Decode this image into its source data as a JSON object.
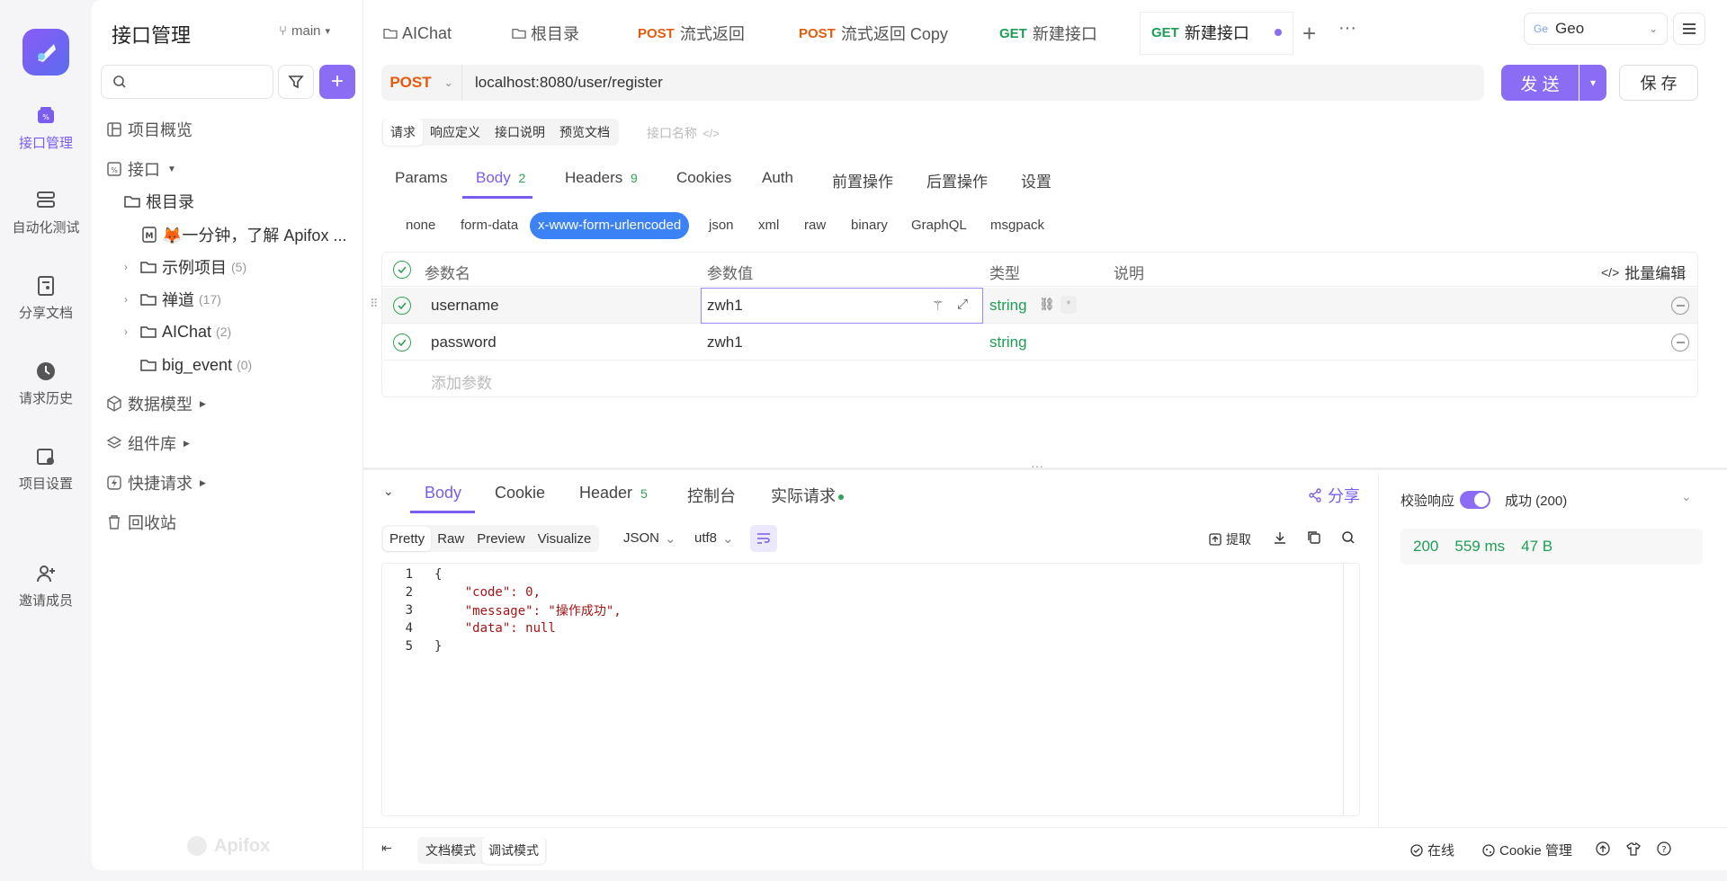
{
  "rail": {
    "items": [
      {
        "label": "接口管理",
        "icon": "api-management-icon"
      },
      {
        "label": "自动化测试",
        "icon": "automation-icon"
      },
      {
        "label": "分享文档",
        "icon": "share-doc-icon"
      },
      {
        "label": "请求历史",
        "icon": "history-icon"
      },
      {
        "label": "项目设置",
        "icon": "project-settings-icon"
      },
      {
        "label": "邀请成员",
        "icon": "invite-user-icon"
      }
    ]
  },
  "panel": {
    "title": "接口管理",
    "branch": "main",
    "search": {
      "value": "",
      "placeholder": ""
    },
    "nav": {
      "overview": "项目概览",
      "apis": "接口",
      "data_model": "数据模型",
      "components": "组件库",
      "quick_request": "快捷请求",
      "trash": "回收站"
    },
    "tree": {
      "root": "根目录",
      "intro": "🦊一分钟，了解 Apifox ...",
      "folders": [
        {
          "name": "示例项目",
          "count": "(5)"
        },
        {
          "name": "禅道",
          "count": "(17)"
        },
        {
          "name": "AIChat",
          "count": "(2)"
        },
        {
          "name": "big_event",
          "count": "(0)"
        }
      ]
    },
    "watermark": "Apifox"
  },
  "tabs": [
    {
      "method": "",
      "label": "AIChat"
    },
    {
      "method": "",
      "label": "根目录"
    },
    {
      "method": "POST",
      "label": "流式返回"
    },
    {
      "method": "POST",
      "label": "流式返回 Copy"
    },
    {
      "method": "GET",
      "label": "新建接口"
    },
    {
      "method": "GET",
      "label": "新建接口"
    }
  ],
  "env": {
    "badge": "Ge",
    "name": "Geo"
  },
  "request": {
    "method": "POST",
    "url": "localhost:8080/user/register",
    "send": "发 送",
    "save": "保 存"
  },
  "modes": [
    "请求",
    "响应定义",
    "接口说明",
    "预览文档"
  ],
  "api_name_placeholder": "接口名称",
  "req_tabs": [
    {
      "label": "Params",
      "count": ""
    },
    {
      "label": "Body",
      "count": "2"
    },
    {
      "label": "Headers",
      "count": "9"
    },
    {
      "label": "Cookies",
      "count": ""
    },
    {
      "label": "Auth",
      "count": ""
    },
    {
      "label": "前置操作",
      "count": ""
    },
    {
      "label": "后置操作",
      "count": ""
    },
    {
      "label": "设置",
      "count": ""
    }
  ],
  "body_types": [
    "none",
    "form-data",
    "x-www-form-urlencoded",
    "json",
    "xml",
    "raw",
    "binary",
    "GraphQL",
    "msgpack"
  ],
  "params_table": {
    "headers": [
      "参数名",
      "参数值",
      "类型",
      "说明"
    ],
    "bulk_edit": "批量编辑",
    "rows": [
      {
        "name": "username",
        "value": "zwh1",
        "type": "string",
        "desc": ""
      },
      {
        "name": "password",
        "value": "zwh1",
        "type": "string",
        "desc": ""
      }
    ],
    "add_placeholder": "添加参数"
  },
  "response": {
    "tabs": [
      {
        "label": "Body",
        "count": ""
      },
      {
        "label": "Cookie",
        "count": ""
      },
      {
        "label": "Header",
        "count": "5"
      },
      {
        "label": "控制台",
        "count": ""
      },
      {
        "label": "实际请求",
        "count": ""
      }
    ],
    "share": "分享",
    "views": [
      "Pretty",
      "Raw",
      "Preview",
      "Visualize"
    ],
    "format": "JSON",
    "encoding": "utf8",
    "extract": "提取",
    "code_lines": [
      {
        "n": "1",
        "text": "{"
      },
      {
        "n": "2",
        "text": "    \"code\": 0,"
      },
      {
        "n": "3",
        "text": "    \"message\": \"操作成功\","
      },
      {
        "n": "4",
        "text": "    \"data\": null"
      },
      {
        "n": "5",
        "text": "}"
      }
    ],
    "validate_label": "校验响应",
    "validate_result": "成功 (200)",
    "status": "200",
    "time": "559 ms",
    "size": "47 B"
  },
  "footer": {
    "doc_mode": "文档模式",
    "debug_mode": "调试模式",
    "online": "在线",
    "cookie_manage": "Cookie 管理"
  },
  "colors": {
    "accent": "#7b5cf0",
    "post": "#e8590c",
    "get": "#1f9d55",
    "string": "#1f9d55"
  }
}
